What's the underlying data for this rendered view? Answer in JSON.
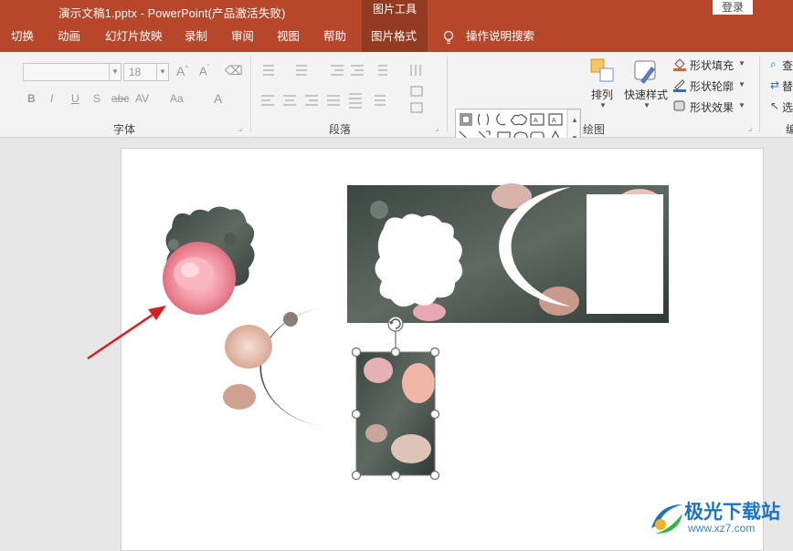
{
  "titlebar": {
    "title": "演示文稿1.pptx  -  PowerPoint(产品激活失败)",
    "context_tab_group": "图片工具",
    "login": "登录"
  },
  "menu": {
    "tabs": [
      "切换",
      "动画",
      "幻灯片放映",
      "录制",
      "审阅",
      "视图",
      "帮助",
      "图片格式"
    ],
    "active_tab": "图片格式",
    "tell_me": "操作说明搜索"
  },
  "ribbon": {
    "font_group": {
      "label": "字体",
      "font_size": "18",
      "buttons": [
        "B",
        "I",
        "U",
        "S",
        "abc",
        "AV",
        "Aa",
        "A"
      ]
    },
    "paragraph_group": {
      "label": "段落"
    },
    "drawing_group": {
      "label": "绘图",
      "arrange": "排列",
      "quick_styles": "快速样式",
      "shape_fill": "形状填充",
      "shape_outline": "形状轮廓",
      "shape_effects": "形状效果"
    },
    "edit_group": {
      "items": [
        "查",
        "替",
        "选"
      ]
    }
  },
  "colors": {
    "accent": "#b7472a",
    "accent_dark": "#933a22",
    "ribbon_bg": "#f3f3f3",
    "annotation_arrow": "#d32020"
  },
  "watermark": {
    "name": "极光下载站",
    "url": "www.xz7.com"
  }
}
